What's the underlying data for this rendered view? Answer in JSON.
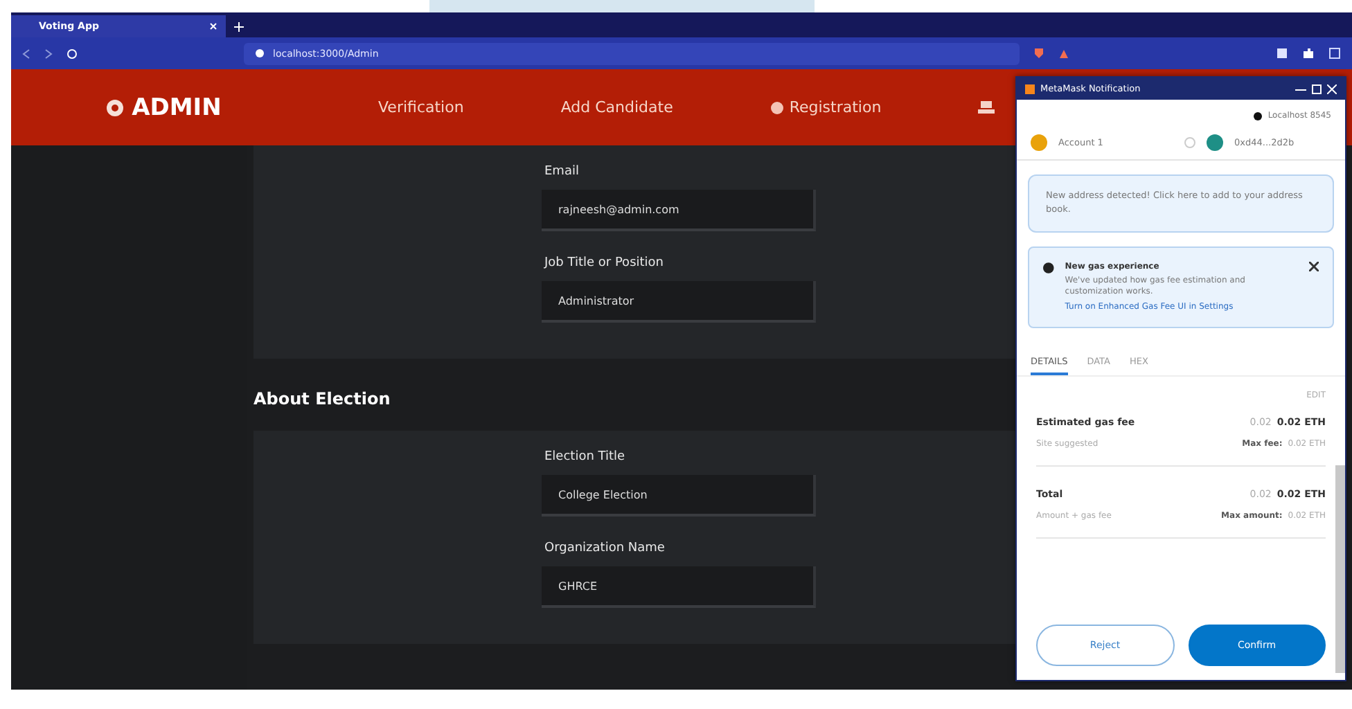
{
  "browser": {
    "tab_title": "Voting App",
    "address": "localhost:3000/Admin"
  },
  "navbar": {
    "brand": "ADMIN",
    "links": [
      {
        "label": "Verification",
        "icon": false
      },
      {
        "label": "Add Candidate",
        "icon": false
      },
      {
        "label": "Registration",
        "icon": true
      }
    ]
  },
  "sections": [
    {
      "fields": [
        {
          "label": "Email",
          "value": "rajneesh@admin.com"
        },
        {
          "label": "Job Title or Position",
          "value": "Administrator"
        }
      ]
    },
    {
      "heading": "About Election",
      "fields": [
        {
          "label": "Election Title",
          "value": "College Election"
        },
        {
          "label": "Organization Name",
          "value": "GHRCE"
        }
      ]
    }
  ],
  "metamask": {
    "window_title": "MetaMask Notification",
    "network": "Localhost 8545",
    "from_account": "Account 1",
    "to_account": "0xd44...2d2b",
    "notice": "New address detected! Click here to add to your address book.",
    "gas_notice": {
      "title": "New gas experience",
      "body": "We've updated how gas fee estimation and customization works.",
      "link": "Turn on Enhanced Gas Fee UI in Settings"
    },
    "tabs": [
      {
        "label": "DETAILS",
        "selected": true
      },
      {
        "label": "DATA",
        "selected": false
      },
      {
        "label": "HEX",
        "selected": false
      }
    ],
    "edit": "EDIT",
    "rows": [
      {
        "label": "Estimated gas fee",
        "sub": "Site suggested",
        "fiat": "0.02",
        "amount": "0.02 ETH",
        "max_label": "Max fee:",
        "max_value": "0.02 ETH"
      },
      {
        "label": "Total",
        "sub": "Amount + gas fee",
        "fiat": "0.02",
        "amount": "0.02 ETH",
        "max_label": "Max amount:",
        "max_value": "0.02 ETH"
      }
    ],
    "buttons": [
      {
        "label": "Reject",
        "kind": "secondary"
      },
      {
        "label": "Confirm",
        "kind": "primary"
      }
    ]
  }
}
